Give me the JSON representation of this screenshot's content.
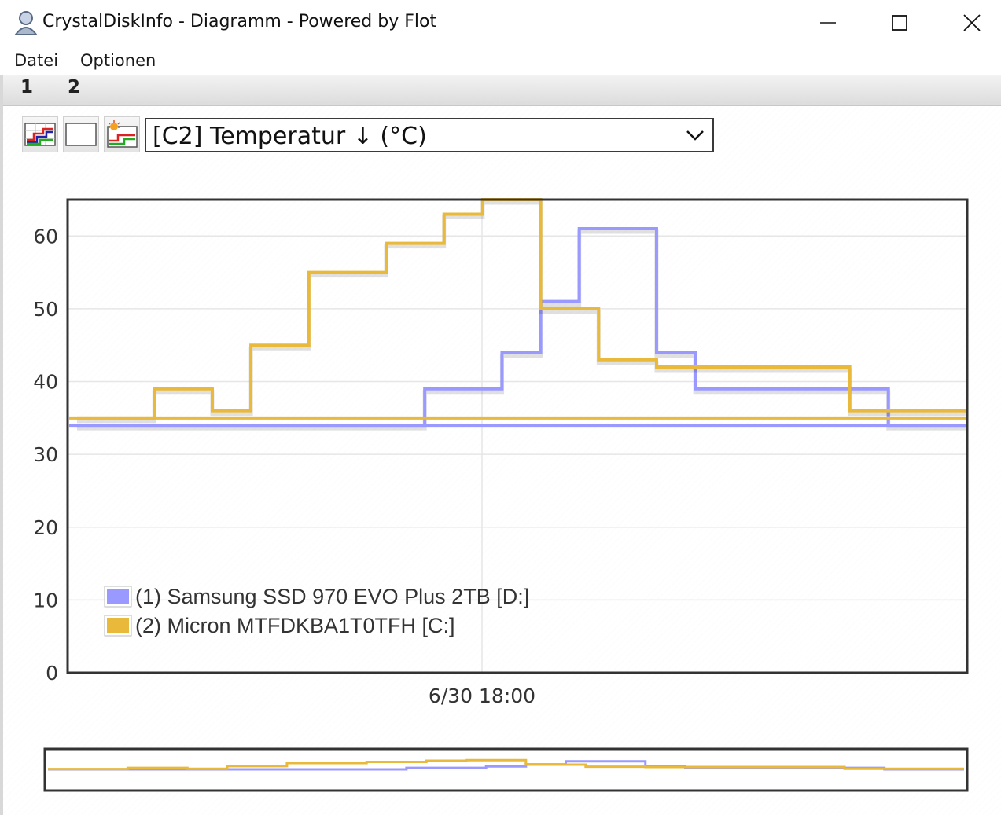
{
  "window": {
    "title": "CrystalDiskInfo - Diagramm - Powered by Flot"
  },
  "menu": {
    "items": [
      "Datei",
      "Optionen"
    ]
  },
  "tabs": [
    "1",
    "2"
  ],
  "toolbar": {
    "buttons": [
      "multi-series-icon",
      "blank-chart-icon",
      "alarm-chart-icon"
    ],
    "selected_attribute": "[C2] Temperatur ↓ (°C)"
  },
  "chart_data": {
    "type": "line",
    "step": true,
    "y_ticks": [
      "0",
      "10",
      "20",
      "30",
      "40",
      "50",
      "60"
    ],
    "ylim": [
      0,
      65
    ],
    "x_tick_labels": [
      "6/30 18:00"
    ],
    "grid": true,
    "legend_position": "bottom-left",
    "series": [
      {
        "name": "(1) Samsung SSD 970 EVO Plus 2TB [D:]",
        "color": "#9999ff",
        "points": [
          [
            0,
            34
          ],
          [
            2,
            34
          ],
          [
            5,
            34
          ],
          [
            9,
            39
          ],
          [
            11,
            44
          ],
          [
            12,
            51
          ],
          [
            13,
            61
          ],
          [
            14,
            61
          ],
          [
            15,
            44
          ],
          [
            16,
            39
          ],
          [
            20,
            39
          ],
          [
            21,
            34
          ],
          [
            23,
            34
          ]
        ]
      },
      {
        "name": "(2) Micron MTFDKBA1T0TFH [C:]",
        "color": "#e8b93a",
        "points": [
          [
            0,
            35
          ],
          [
            2,
            39
          ],
          [
            3.5,
            36
          ],
          [
            4.5,
            45
          ],
          [
            6,
            55
          ],
          [
            8,
            59
          ],
          [
            9.5,
            63
          ],
          [
            10.5,
            65
          ],
          [
            12,
            50
          ],
          [
            13.5,
            43
          ],
          [
            15,
            42
          ],
          [
            20,
            36
          ],
          [
            23,
            36
          ]
        ]
      }
    ]
  }
}
